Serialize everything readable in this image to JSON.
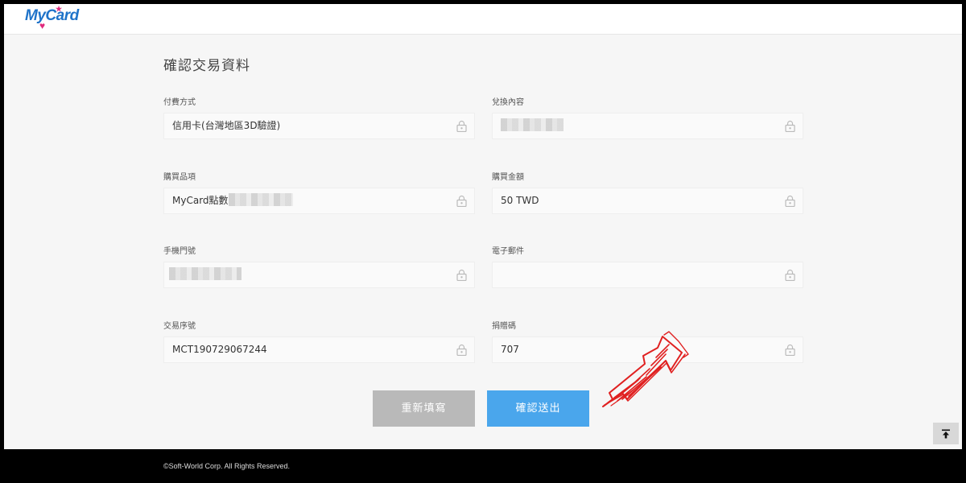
{
  "brand": {
    "logo_text_my": "My",
    "logo_text_card": "Card"
  },
  "page": {
    "title": "確認交易資料"
  },
  "fields": [
    {
      "label": "付費方式",
      "value": "信用卡(台灣地區3D驗證)",
      "redacted": false
    },
    {
      "label": "兌換內容",
      "value": "",
      "redacted": true
    },
    {
      "label": "購買品項",
      "value": "MyCard點數",
      "redacted": true
    },
    {
      "label": "購買金額",
      "value": "50 TWD",
      "redacted": false
    },
    {
      "label": "手機門號",
      "value": "",
      "redacted": true
    },
    {
      "label": "電子郵件",
      "value": "",
      "redacted": false
    },
    {
      "label": "交易序號",
      "value": "MCT190729067244",
      "redacted": false
    },
    {
      "label": "捐贈碼",
      "value": "707",
      "redacted": false
    }
  ],
  "buttons": {
    "reset_label": "重新填寫",
    "submit_label": "確認送出"
  },
  "footer": {
    "copyright": "©Soft-World Corp. All Rights Reserved."
  },
  "colors": {
    "submit": "#4aa6ec",
    "reset": "#b9b9b9",
    "annotation_arrow": "#e02020",
    "logo_blue": "#1f73c9",
    "logo_pink": "#e02a7d"
  }
}
